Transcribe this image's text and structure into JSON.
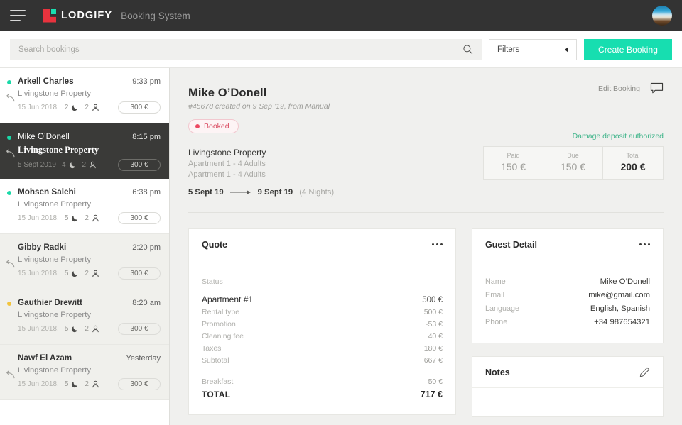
{
  "topbar": {
    "menu_icon": "hamburger-icon",
    "logo_text": "LODGIFY",
    "app_name": "Booking System",
    "avatar": "user-avatar"
  },
  "search": {
    "placeholder": "Search bookings",
    "value": "",
    "icon": "search-icon",
    "filters_label": "Filters",
    "create_label": "Create Booking"
  },
  "sidebar": {
    "bookings": [
      {
        "name": "Arkell Charles",
        "time": "9:33 pm",
        "property": "Livingstone Property",
        "date": "15 Jun 2018,",
        "nights": "2",
        "guests": "2",
        "price": "300 €",
        "dot": "#19d9a8",
        "state": "unread",
        "replied": true
      },
      {
        "name": "Mike O’Donell",
        "time": "8:15 pm",
        "property": "Livingstone Property",
        "date": "5 Sept 2019",
        "nights": "4",
        "guests": "2",
        "price": "300 €",
        "dot": "#19d9a8",
        "state": "selected",
        "replied": true
      },
      {
        "name": "Mohsen Salehi",
        "time": "6:38 pm",
        "property": "Livingstone Property",
        "date": "15 Jun 2018,",
        "nights": "5",
        "guests": "2",
        "price": "300 €",
        "dot": "#19d9a8",
        "state": "unread",
        "replied": false
      },
      {
        "name": "Gibby Radki",
        "time": "2:20 pm",
        "property": "Livingstone Property",
        "date": "15 Jun 2018,",
        "nights": "5",
        "guests": "2",
        "price": "300 €",
        "dot": "",
        "state": "read",
        "replied": true
      },
      {
        "name": "Gauthier Drewitt",
        "time": "8:20 am",
        "property": "Livingstone Property",
        "date": "15 Jun 2018,",
        "nights": "5",
        "guests": "2",
        "price": "300 €",
        "dot": "#f2c43d",
        "state": "read",
        "replied": false
      },
      {
        "name": "Nawf El Azam",
        "time": "Yesterday",
        "property": "Livingstone Property",
        "date": "15 Jun 2018,",
        "nights": "5",
        "guests": "2",
        "price": "300 €",
        "dot": "",
        "state": "read",
        "replied": true
      }
    ]
  },
  "booking": {
    "guest_name": "Mike O’Donell",
    "meta": "#45678 created on 9 Sep ’19, from Manual",
    "status": "Booked",
    "status_color": "#d94a60",
    "edit_label": "Edit Booking",
    "comment_icon": "comment-icon",
    "property": "Livingstone Property",
    "unit_line_1": "Apartment 1 - 4 Adults",
    "unit_line_2": "Apartment 1 - 4 Adults",
    "checkin": "5 Sept 19",
    "checkout": "9 Sept 19",
    "nights_label": "(4 Nights)",
    "deposit_note": "Damage deposit authorized",
    "deposit_color": "#3eb489",
    "money": [
      {
        "label": "Paid",
        "value": "150 €"
      },
      {
        "label": "Due",
        "value": "150 €"
      },
      {
        "label": "Total",
        "value": "200 €"
      }
    ]
  },
  "quote": {
    "title": "Quote",
    "menu_icon": "more-options-icon",
    "status_label": "Status",
    "main_item": {
      "label": "Apartment #1",
      "value": "500 €"
    },
    "lines": [
      {
        "label": "Rental type",
        "value": "500 €"
      },
      {
        "label": "Promotion",
        "value": "-53 €"
      },
      {
        "label": "Cleaning fee",
        "value": "40 €"
      },
      {
        "label": "Taxes",
        "value": "180 €"
      },
      {
        "label": "Subtotal",
        "value": "667 €"
      }
    ],
    "extra": {
      "label": "Breakfast",
      "value": "50 €"
    },
    "total": {
      "label": "TOTAL",
      "value": "717 €"
    }
  },
  "guest_detail": {
    "title": "Guest Detail",
    "menu_icon": "more-options-icon",
    "rows": [
      {
        "label": "Name",
        "value": "Mike O’Donell"
      },
      {
        "label": "Email",
        "value": "mike@gmail.com"
      },
      {
        "label": "Language",
        "value": "English, Spanish"
      },
      {
        "label": "Phone",
        "value": "+34 987654321"
      }
    ]
  },
  "notes": {
    "title": "Notes",
    "edit_icon": "pencil-icon"
  }
}
